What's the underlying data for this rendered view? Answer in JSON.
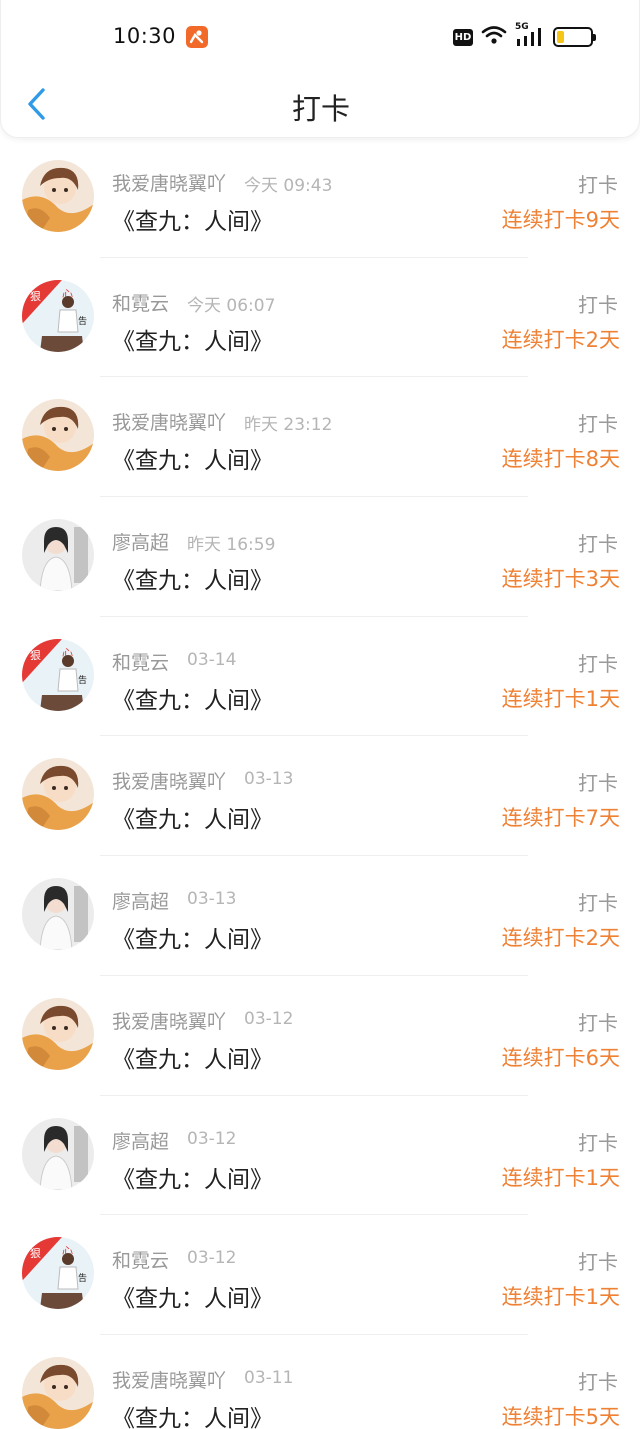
{
  "status_bar": {
    "time": "10:30",
    "network": "5G",
    "hd_label": "HD",
    "battery_percent": 22
  },
  "nav": {
    "title": "打卡",
    "back_icon": "chevron-left-icon"
  },
  "colors": {
    "accent_blue": "#2f9be6",
    "streak_orange": "#ef8135",
    "badge_orange": "#f26a2a"
  },
  "entries": [
    {
      "user": "我爱唐晓翼吖",
      "time": "今天 09:43",
      "title": "《查九：人间》",
      "action": "打卡",
      "streak": "连续打卡9天",
      "avatar": "anime-avatar"
    },
    {
      "user": "和霓云",
      "time": "今天 06:07",
      "title": "《查九：人间》",
      "action": "打卡",
      "streak": "连续打卡2天",
      "avatar": "poster-avatar"
    },
    {
      "user": "我爱唐晓翼吖",
      "time": "昨天 23:12",
      "title": "《查九：人间》",
      "action": "打卡",
      "streak": "连续打卡8天",
      "avatar": "anime-avatar"
    },
    {
      "user": "廖高超",
      "time": "昨天 16:59",
      "title": "《查九：人间》",
      "action": "打卡",
      "streak": "连续打卡3天",
      "avatar": "photo-avatar"
    },
    {
      "user": "和霓云",
      "time": "03-14",
      "title": "《查九：人间》",
      "action": "打卡",
      "streak": "连续打卡1天",
      "avatar": "poster-avatar"
    },
    {
      "user": "我爱唐晓翼吖",
      "time": "03-13",
      "title": "《查九：人间》",
      "action": "打卡",
      "streak": "连续打卡7天",
      "avatar": "anime-avatar"
    },
    {
      "user": "廖高超",
      "time": "03-13",
      "title": "《查九：人间》",
      "action": "打卡",
      "streak": "连续打卡2天",
      "avatar": "photo-avatar"
    },
    {
      "user": "我爱唐晓翼吖",
      "time": "03-12",
      "title": "《查九：人间》",
      "action": "打卡",
      "streak": "连续打卡6天",
      "avatar": "anime-avatar"
    },
    {
      "user": "廖高超",
      "time": "03-12",
      "title": "《查九：人间》",
      "action": "打卡",
      "streak": "连续打卡1天",
      "avatar": "photo-avatar"
    },
    {
      "user": "和霓云",
      "time": "03-12",
      "title": "《查九：人间》",
      "action": "打卡",
      "streak": "连续打卡1天",
      "avatar": "poster-avatar"
    },
    {
      "user": "我爱唐晓翼吖",
      "time": "03-11",
      "title": "《查九：人间》",
      "action": "打卡",
      "streak": "连续打卡5天",
      "avatar": "anime-avatar"
    }
  ]
}
